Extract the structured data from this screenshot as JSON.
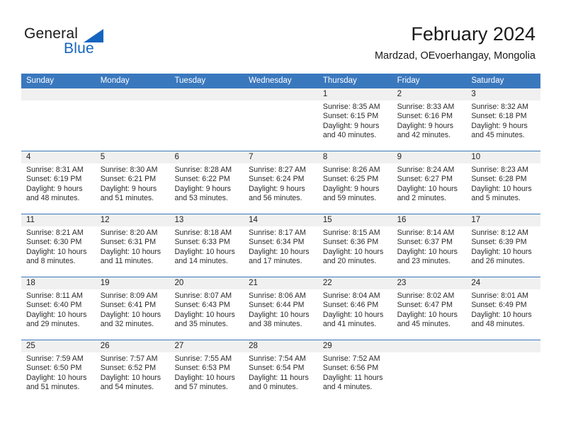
{
  "brand": {
    "name_part1": "General",
    "name_part2": "Blue",
    "accent_color": "#1565c0"
  },
  "header": {
    "title": "February 2024",
    "subtitle": "Mardzad, OEvoerhangay, Mongolia"
  },
  "theme": {
    "header_row_bg": "#3a78be",
    "date_strip_bg": "#f0f0f0",
    "grid_line": "#3a78be"
  },
  "weekdays": [
    "Sunday",
    "Monday",
    "Tuesday",
    "Wednesday",
    "Thursday",
    "Friday",
    "Saturday"
  ],
  "weeks": [
    [
      {
        "day": "",
        "lines": []
      },
      {
        "day": "",
        "lines": []
      },
      {
        "day": "",
        "lines": []
      },
      {
        "day": "",
        "lines": []
      },
      {
        "day": "1",
        "lines": [
          "Sunrise: 8:35 AM",
          "Sunset: 6:15 PM",
          "Daylight: 9 hours",
          "and 40 minutes."
        ]
      },
      {
        "day": "2",
        "lines": [
          "Sunrise: 8:33 AM",
          "Sunset: 6:16 PM",
          "Daylight: 9 hours",
          "and 42 minutes."
        ]
      },
      {
        "day": "3",
        "lines": [
          "Sunrise: 8:32 AM",
          "Sunset: 6:18 PM",
          "Daylight: 9 hours",
          "and 45 minutes."
        ]
      }
    ],
    [
      {
        "day": "4",
        "lines": [
          "Sunrise: 8:31 AM",
          "Sunset: 6:19 PM",
          "Daylight: 9 hours",
          "and 48 minutes."
        ]
      },
      {
        "day": "5",
        "lines": [
          "Sunrise: 8:30 AM",
          "Sunset: 6:21 PM",
          "Daylight: 9 hours",
          "and 51 minutes."
        ]
      },
      {
        "day": "6",
        "lines": [
          "Sunrise: 8:28 AM",
          "Sunset: 6:22 PM",
          "Daylight: 9 hours",
          "and 53 minutes."
        ]
      },
      {
        "day": "7",
        "lines": [
          "Sunrise: 8:27 AM",
          "Sunset: 6:24 PM",
          "Daylight: 9 hours",
          "and 56 minutes."
        ]
      },
      {
        "day": "8",
        "lines": [
          "Sunrise: 8:26 AM",
          "Sunset: 6:25 PM",
          "Daylight: 9 hours",
          "and 59 minutes."
        ]
      },
      {
        "day": "9",
        "lines": [
          "Sunrise: 8:24 AM",
          "Sunset: 6:27 PM",
          "Daylight: 10 hours",
          "and 2 minutes."
        ]
      },
      {
        "day": "10",
        "lines": [
          "Sunrise: 8:23 AM",
          "Sunset: 6:28 PM",
          "Daylight: 10 hours",
          "and 5 minutes."
        ]
      }
    ],
    [
      {
        "day": "11",
        "lines": [
          "Sunrise: 8:21 AM",
          "Sunset: 6:30 PM",
          "Daylight: 10 hours",
          "and 8 minutes."
        ]
      },
      {
        "day": "12",
        "lines": [
          "Sunrise: 8:20 AM",
          "Sunset: 6:31 PM",
          "Daylight: 10 hours",
          "and 11 minutes."
        ]
      },
      {
        "day": "13",
        "lines": [
          "Sunrise: 8:18 AM",
          "Sunset: 6:33 PM",
          "Daylight: 10 hours",
          "and 14 minutes."
        ]
      },
      {
        "day": "14",
        "lines": [
          "Sunrise: 8:17 AM",
          "Sunset: 6:34 PM",
          "Daylight: 10 hours",
          "and 17 minutes."
        ]
      },
      {
        "day": "15",
        "lines": [
          "Sunrise: 8:15 AM",
          "Sunset: 6:36 PM",
          "Daylight: 10 hours",
          "and 20 minutes."
        ]
      },
      {
        "day": "16",
        "lines": [
          "Sunrise: 8:14 AM",
          "Sunset: 6:37 PM",
          "Daylight: 10 hours",
          "and 23 minutes."
        ]
      },
      {
        "day": "17",
        "lines": [
          "Sunrise: 8:12 AM",
          "Sunset: 6:39 PM",
          "Daylight: 10 hours",
          "and 26 minutes."
        ]
      }
    ],
    [
      {
        "day": "18",
        "lines": [
          "Sunrise: 8:11 AM",
          "Sunset: 6:40 PM",
          "Daylight: 10 hours",
          "and 29 minutes."
        ]
      },
      {
        "day": "19",
        "lines": [
          "Sunrise: 8:09 AM",
          "Sunset: 6:41 PM",
          "Daylight: 10 hours",
          "and 32 minutes."
        ]
      },
      {
        "day": "20",
        "lines": [
          "Sunrise: 8:07 AM",
          "Sunset: 6:43 PM",
          "Daylight: 10 hours",
          "and 35 minutes."
        ]
      },
      {
        "day": "21",
        "lines": [
          "Sunrise: 8:06 AM",
          "Sunset: 6:44 PM",
          "Daylight: 10 hours",
          "and 38 minutes."
        ]
      },
      {
        "day": "22",
        "lines": [
          "Sunrise: 8:04 AM",
          "Sunset: 6:46 PM",
          "Daylight: 10 hours",
          "and 41 minutes."
        ]
      },
      {
        "day": "23",
        "lines": [
          "Sunrise: 8:02 AM",
          "Sunset: 6:47 PM",
          "Daylight: 10 hours",
          "and 45 minutes."
        ]
      },
      {
        "day": "24",
        "lines": [
          "Sunrise: 8:01 AM",
          "Sunset: 6:49 PM",
          "Daylight: 10 hours",
          "and 48 minutes."
        ]
      }
    ],
    [
      {
        "day": "25",
        "lines": [
          "Sunrise: 7:59 AM",
          "Sunset: 6:50 PM",
          "Daylight: 10 hours",
          "and 51 minutes."
        ]
      },
      {
        "day": "26",
        "lines": [
          "Sunrise: 7:57 AM",
          "Sunset: 6:52 PM",
          "Daylight: 10 hours",
          "and 54 minutes."
        ]
      },
      {
        "day": "27",
        "lines": [
          "Sunrise: 7:55 AM",
          "Sunset: 6:53 PM",
          "Daylight: 10 hours",
          "and 57 minutes."
        ]
      },
      {
        "day": "28",
        "lines": [
          "Sunrise: 7:54 AM",
          "Sunset: 6:54 PM",
          "Daylight: 11 hours",
          "and 0 minutes."
        ]
      },
      {
        "day": "29",
        "lines": [
          "Sunrise: 7:52 AM",
          "Sunset: 6:56 PM",
          "Daylight: 11 hours",
          "and 4 minutes."
        ]
      },
      {
        "day": "",
        "lines": []
      },
      {
        "day": "",
        "lines": []
      }
    ]
  ]
}
